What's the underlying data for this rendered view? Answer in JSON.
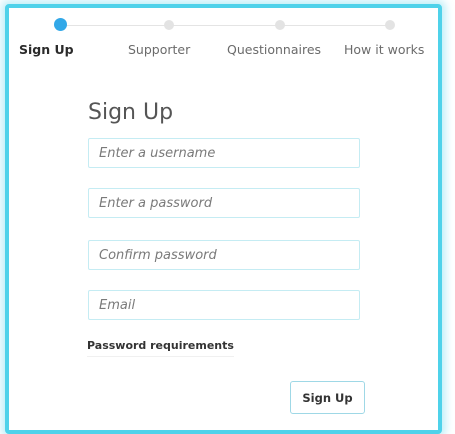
{
  "stepper": {
    "steps": [
      {
        "label": "Sign Up",
        "active": true
      },
      {
        "label": "Supporter",
        "active": false
      },
      {
        "label": "Questionnaires",
        "active": false
      },
      {
        "label": "How it works",
        "active": false
      }
    ]
  },
  "form": {
    "title": "Sign Up",
    "username_placeholder": "Enter a username",
    "password_placeholder": "Enter a password",
    "confirm_placeholder": "Confirm password",
    "email_placeholder": "Email",
    "requirements_link": "Password requirements",
    "submit_label": "Sign Up"
  },
  "colors": {
    "accent": "#32a8e8",
    "frame_border": "#4fd2ea",
    "field_border": "#c5ecf3"
  }
}
